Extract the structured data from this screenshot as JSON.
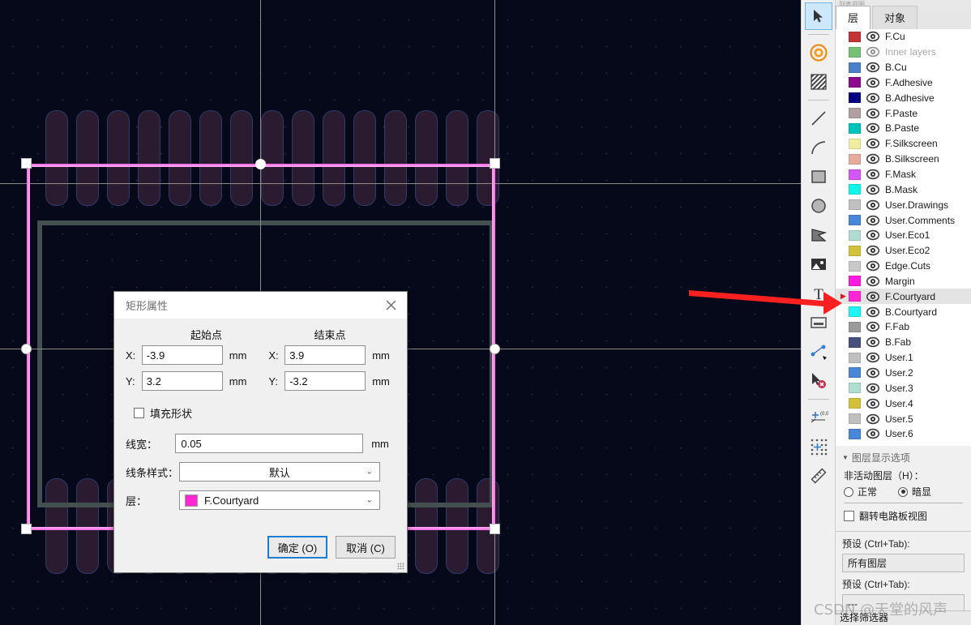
{
  "canvas": {
    "background_color": "#06091a",
    "courtyard_color": "#ff79e8",
    "edge_color": "#44504f",
    "pad_color": "#2a1b30",
    "axis_color": "#8d8d86",
    "grid_dot_color": "#3a4060"
  },
  "vtoolbar": {
    "tools": [
      {
        "name": "select-cursor-icon",
        "label": "Select",
        "active": true
      },
      {
        "name": "pad-icon",
        "label": "Add pad",
        "active": false
      },
      {
        "name": "zone-icon",
        "label": "Add zone",
        "active": false
      },
      {
        "name": "line-icon",
        "label": "Draw line",
        "active": false
      },
      {
        "name": "arc-icon",
        "label": "Draw arc",
        "active": false
      },
      {
        "name": "rectangle-icon",
        "label": "Draw rectangle",
        "active": false
      },
      {
        "name": "circle-icon",
        "label": "Draw circle",
        "active": false
      },
      {
        "name": "polygon-icon",
        "label": "Draw polygon",
        "active": false
      },
      {
        "name": "image-icon",
        "label": "Place image",
        "active": false
      },
      {
        "name": "text-icon",
        "label": "Add text",
        "active": false
      },
      {
        "name": "textbox-icon",
        "label": "Add text box",
        "active": false
      },
      {
        "name": "dimension-icon",
        "label": "Add dimension",
        "active": false
      },
      {
        "name": "delete-icon",
        "label": "Delete item",
        "active": false
      },
      {
        "name": "origin-icon",
        "label": "Set origin",
        "active": false
      },
      {
        "name": "grid-origin-icon",
        "label": "Grid origin",
        "active": false
      },
      {
        "name": "measure-icon",
        "label": "Measure tool",
        "active": false
      }
    ]
  },
  "panel": {
    "topstrip": "列表视图",
    "tabs": [
      {
        "label": "层",
        "selected": true
      },
      {
        "label": "对象",
        "selected": false
      }
    ],
    "layers": [
      {
        "name": "F.Cu",
        "color": "#c53434",
        "dim": false,
        "selected": false
      },
      {
        "name": "Inner layers",
        "color": "#74c174",
        "dim": true,
        "selected": false
      },
      {
        "name": "B.Cu",
        "color": "#4a7fc8",
        "dim": false,
        "selected": false
      },
      {
        "name": "F.Adhesive",
        "color": "#8d0a8d",
        "dim": false,
        "selected": false
      },
      {
        "name": "B.Adhesive",
        "color": "#000080",
        "dim": false,
        "selected": false
      },
      {
        "name": "F.Paste",
        "color": "#b2a0a0",
        "dim": false,
        "selected": false
      },
      {
        "name": "B.Paste",
        "color": "#00c3bc",
        "dim": false,
        "selected": false
      },
      {
        "name": "F.Silkscreen",
        "color": "#f0eda0",
        "dim": false,
        "selected": false
      },
      {
        "name": "B.Silkscreen",
        "color": "#e8aa9c",
        "dim": false,
        "selected": false
      },
      {
        "name": "F.Mask",
        "color": "#d356f5",
        "dim": false,
        "selected": false
      },
      {
        "name": "B.Mask",
        "color": "#11f5ea",
        "dim": false,
        "selected": false
      },
      {
        "name": "User.Drawings",
        "color": "#c0c0c0",
        "dim": false,
        "selected": false
      },
      {
        "name": "User.Comments",
        "color": "#4a87d8",
        "dim": false,
        "selected": false
      },
      {
        "name": "User.Eco1",
        "color": "#b1dcd2",
        "dim": false,
        "selected": false
      },
      {
        "name": "User.Eco2",
        "color": "#d4c13a",
        "dim": false,
        "selected": false
      },
      {
        "name": "Edge.Cuts",
        "color": "#c8c8c8",
        "dim": false,
        "selected": false
      },
      {
        "name": "Margin",
        "color": "#ff1ae0",
        "dim": false,
        "selected": false
      },
      {
        "name": "F.Courtyard",
        "color": "#ff26d4",
        "dim": false,
        "selected": true
      },
      {
        "name": "B.Courtyard",
        "color": "#1ff3f3",
        "dim": false,
        "selected": false
      },
      {
        "name": "F.Fab",
        "color": "#9a9a9a",
        "dim": false,
        "selected": false
      },
      {
        "name": "B.Fab",
        "color": "#46507e",
        "dim": false,
        "selected": false
      },
      {
        "name": "User.1",
        "color": "#c0c0c0",
        "dim": false,
        "selected": false
      },
      {
        "name": "User.2",
        "color": "#4a87d8",
        "dim": false,
        "selected": false
      },
      {
        "name": "User.3",
        "color": "#b1dcd2",
        "dim": false,
        "selected": false
      },
      {
        "name": "User.4",
        "color": "#d4c13a",
        "dim": false,
        "selected": false
      },
      {
        "name": "User.5",
        "color": "#c0c0c0",
        "dim": false,
        "selected": false
      },
      {
        "name": "User.6",
        "color": "#4a87d8",
        "dim": false,
        "selected": false
      }
    ],
    "display_options": {
      "title": "图层显示选项",
      "inactive_layers_label": "非活动图层（H）：",
      "radio_normal": "正常",
      "radio_dim": "暗显",
      "radio_selected": "暗显",
      "flip_board_label": "翻转电路板视图",
      "flip_board_checked": false
    },
    "presets": [
      {
        "label": "预设 (Ctrl+Tab):",
        "value": "所有图层"
      },
      {
        "label": "预设 (Ctrl+Tab):",
        "value": "---"
      }
    ],
    "statusbar": "选择筛选器"
  },
  "dialog": {
    "title": "矩形属性",
    "close_icon": "✕",
    "headers": {
      "start": "起始点",
      "end": "结束点"
    },
    "fields": {
      "start_x_label": "X:",
      "start_x_value": "-3.9",
      "start_x_unit": "mm",
      "start_y_label": "Y:",
      "start_y_value": "3.2",
      "start_y_unit": "mm",
      "end_x_label": "X:",
      "end_x_value": "3.9",
      "end_x_unit": "mm",
      "end_y_label": "Y:",
      "end_y_value": "-3.2",
      "end_y_unit": "mm"
    },
    "fill_shape_label": "填充形状",
    "fill_shape_checked": false,
    "line_width_label": "线宽：",
    "line_width_value": "0.05",
    "line_width_unit": "mm",
    "line_style_label": "线条样式：",
    "line_style_value": "默认",
    "layer_label": "层：",
    "layer_value": "F.Courtyard",
    "layer_color": "#ff26d4",
    "ok_button": "确定 (O)",
    "cancel_button": "取消 (C)"
  },
  "annotation": {
    "arrow_color": "#fb2020",
    "arrow_target": "F.Courtyard"
  },
  "watermark": "CSDN @天堂的风声"
}
